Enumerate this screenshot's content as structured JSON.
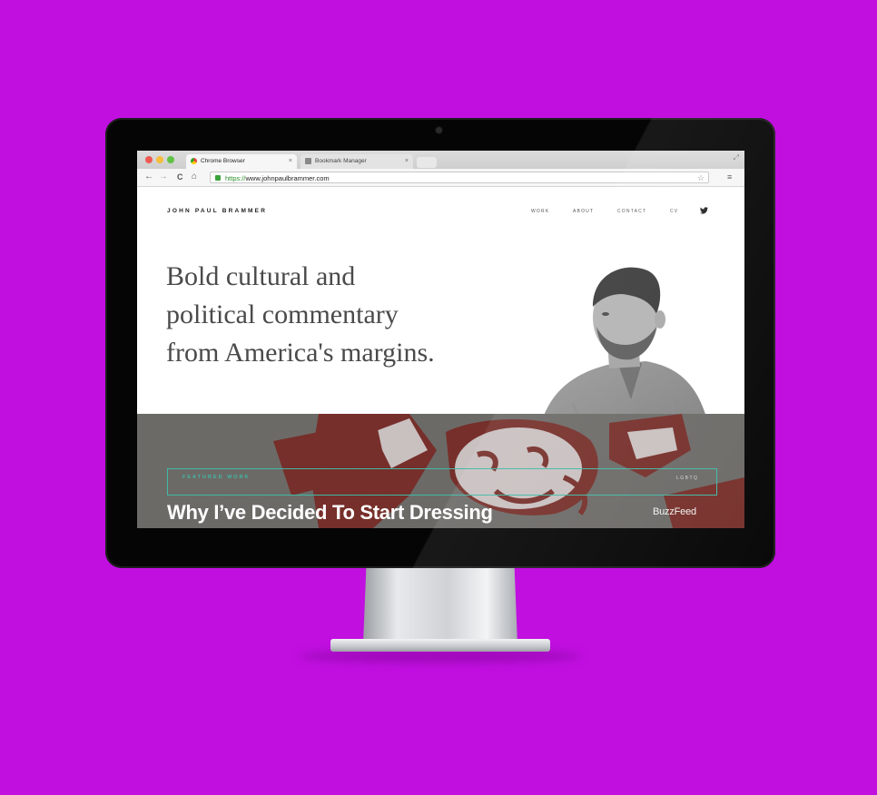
{
  "browser": {
    "tabs": [
      {
        "label": "Chrome Browser",
        "close": "×"
      },
      {
        "label": "Bookmark Manager",
        "close": "×"
      }
    ],
    "nav": {
      "back": "←",
      "forward": "→",
      "reload": "C",
      "home": "⌂"
    },
    "address": {
      "scheme": "https://",
      "host": "www.johnpaulbrammer.com"
    },
    "star": "☆",
    "menu": "≡",
    "expand": "⤢"
  },
  "site": {
    "logo": "JOHN PAUL BRAMMER",
    "nav": [
      "WORK",
      "ABOUT",
      "CONTACT",
      "CV"
    ],
    "twitter_glyph": "🐦",
    "hero": {
      "lines": [
        "Bold cultural and",
        "political commentary",
        "from America's margins."
      ]
    },
    "featured": {
      "label": "FEATURED WORK",
      "tag": "LGBTQ",
      "title": "Why I’ve Decided To Start Dressing",
      "publication": "BuzzFeed"
    }
  },
  "colors": {
    "background": "#c10fe0",
    "accent": "#3fb9a5",
    "hero_text": "#4a4a4a",
    "illustration": "#7a1c16"
  },
  "icons": [
    "apple-style-traffic-lights",
    "chrome-favicon",
    "bookmark-icon",
    "back-arrow-icon",
    "forward-arrow-icon",
    "reload-icon",
    "home-icon",
    "lock-icon",
    "star-icon",
    "menu-icon",
    "twitter-icon",
    "camera-icon"
  ]
}
